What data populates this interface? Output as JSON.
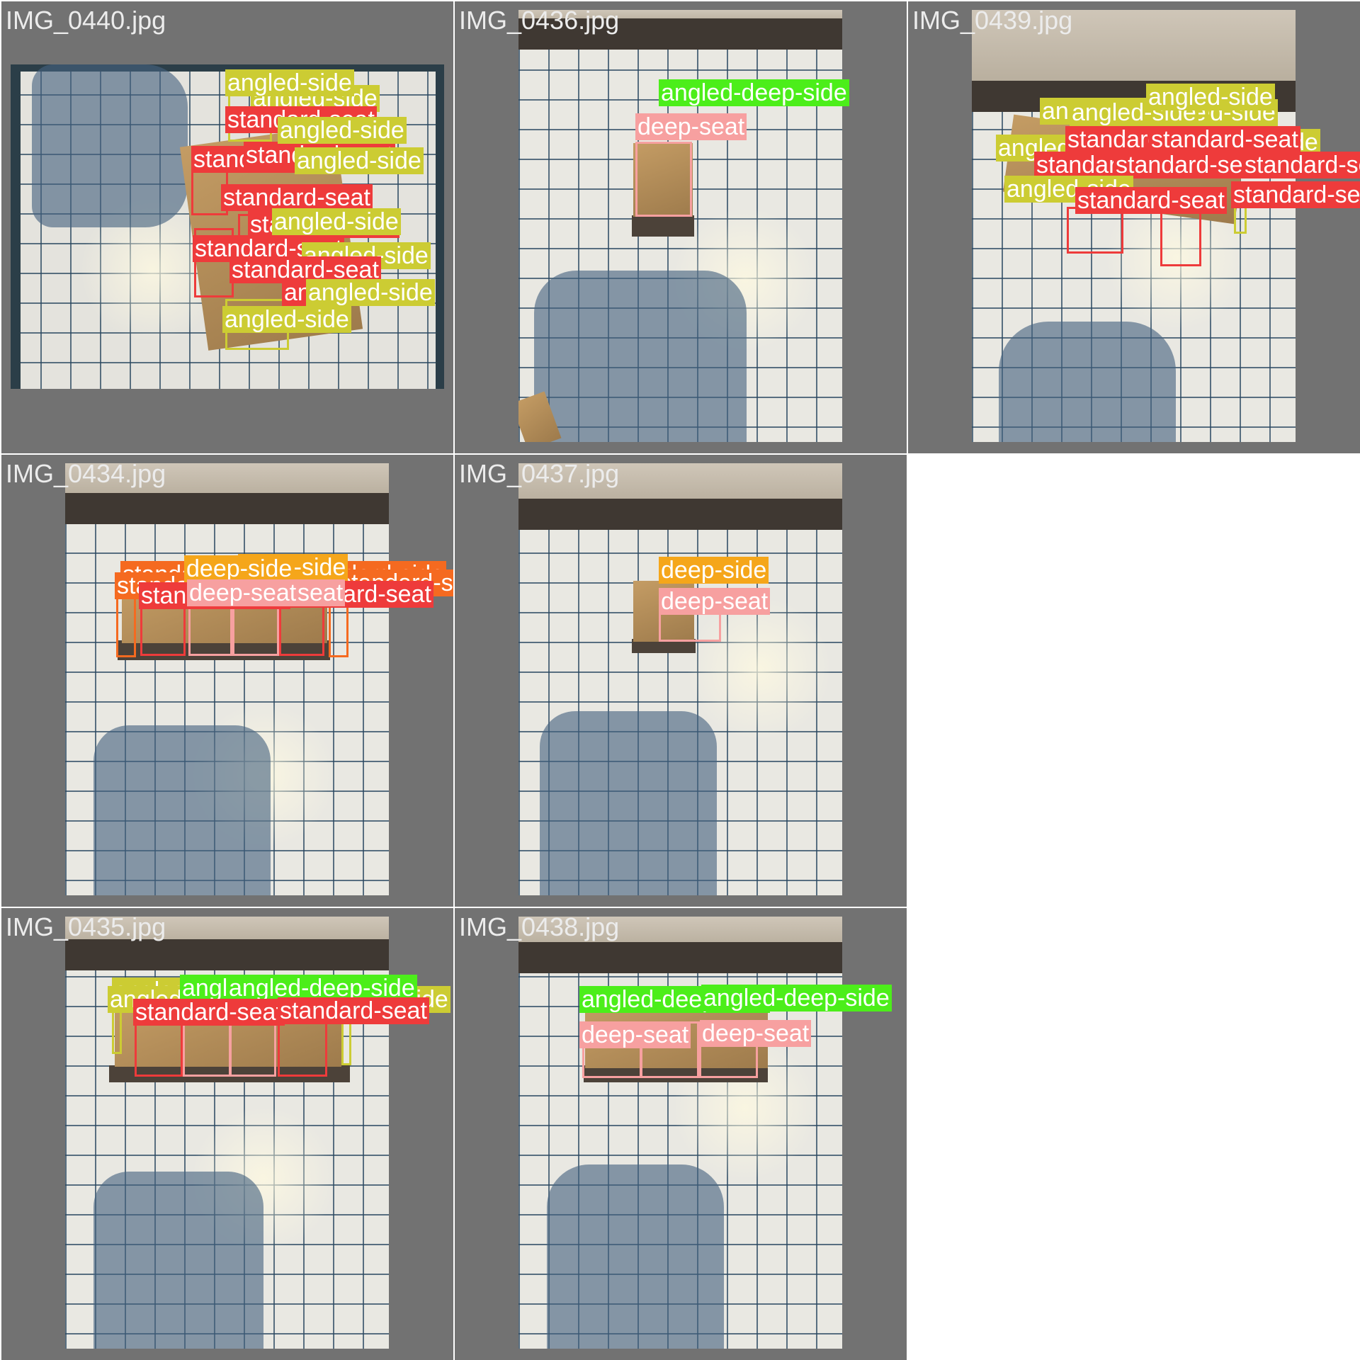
{
  "colors": {
    "angled-side": "#cccc33",
    "standard-seat": "#ee3b3b",
    "angled-deep-side": "#4cee1a",
    "deep-seat": "#f7a0a0",
    "deep-side": "#f5a61a",
    "standard-side": "#f56a20"
  },
  "tiles": {
    "t0440": {
      "filename": "IMG_0440.jpg",
      "labels": [
        "angled-side",
        "angled-side",
        "standard-seat",
        "angled-side",
        "standard-seat",
        "standard-seat",
        "angled-side",
        "standard-seat",
        "angled-side",
        "standard-seat",
        "angled-side",
        "standard-seat",
        "angled-side",
        "standard-seat",
        "angled-side",
        "angled-side"
      ]
    },
    "t0436": {
      "filename": "IMG_0436.jpg",
      "labels": [
        "angled-deep-side",
        "deep-seat"
      ]
    },
    "t0439": {
      "filename": "IMG_0439.jpg",
      "labels": [
        "angled-side",
        "angled-side",
        "angled-side",
        "angled-side",
        "angled-side",
        "standard-seat",
        "standard-seat",
        "angled-side",
        "standard-seat",
        "standard-seat",
        "angled-side",
        "standard-seat",
        "angled-side",
        "standard-seat",
        "standard-seat"
      ]
    },
    "t0434": {
      "filename": "IMG_0434.jpg",
      "labels": [
        "standard-side",
        "deep-side",
        "deep-side",
        "standard-side",
        "standard-side",
        "standard-side",
        "standard-seat",
        "deep-seat",
        "deep-seat",
        "standard-seat"
      ]
    },
    "t0437": {
      "filename": "IMG_0437.jpg",
      "labels": [
        "deep-side",
        "deep-seat"
      ]
    },
    "t0435": {
      "filename": "IMG_0435.jpg",
      "labels": [
        "angled-side",
        "angled-side",
        "angled-deep-side",
        "angled-deep-side",
        "angled-side",
        "standard-seat",
        "standard-seat"
      ]
    },
    "t0438": {
      "filename": "IMG_0438.jpg",
      "labels": [
        "angled-deep-side",
        "angled-deep-side",
        "deep-seat",
        "deep-seat"
      ]
    }
  }
}
